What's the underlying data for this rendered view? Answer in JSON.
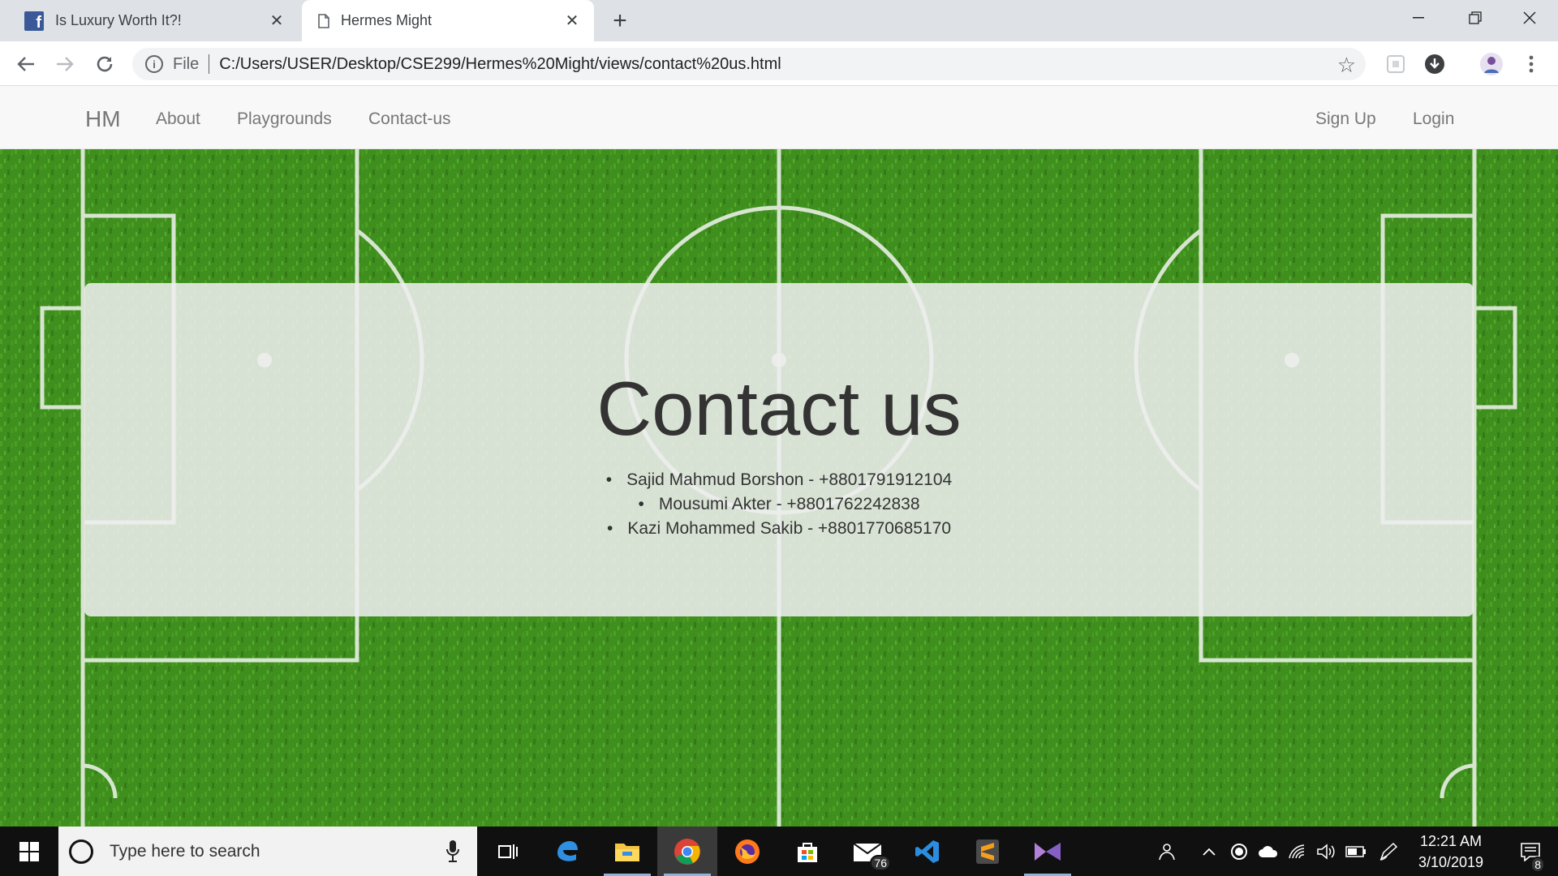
{
  "browser": {
    "tabs": [
      {
        "title": "Is Luxury Worth It?!",
        "icon": "facebook-icon",
        "active": false
      },
      {
        "title": "Hermes Might",
        "icon": "page-icon",
        "active": true
      }
    ],
    "address": {
      "scheme_label": "File",
      "url": "C:/Users/USER/Desktop/CSE299/Hermes%20Might/views/contact%20us.html"
    }
  },
  "site": {
    "brand": "HM",
    "nav": {
      "left": [
        "About",
        "Playgrounds",
        "Contact-us"
      ],
      "right": [
        "Sign Up",
        "Login"
      ]
    },
    "heading": "Contact us",
    "contacts": [
      "Sajid Mahmud Borshon - +8801791912104",
      "Mousumi Akter - +8801762242838",
      "Kazi Mohammed Sakib - +8801770685170"
    ]
  },
  "taskbar": {
    "search_placeholder": "Type here to search",
    "mail_badge": "76",
    "notification_badge": "8",
    "clock": {
      "time": "12:21 AM",
      "date": "3/10/2019"
    }
  },
  "colors": {
    "grass": "#3f8f1e",
    "jumbotron": "#eeeeee",
    "navbar": "#f8f8f8",
    "taskbar": "#101010",
    "tabstrip": "#dee1e6"
  }
}
